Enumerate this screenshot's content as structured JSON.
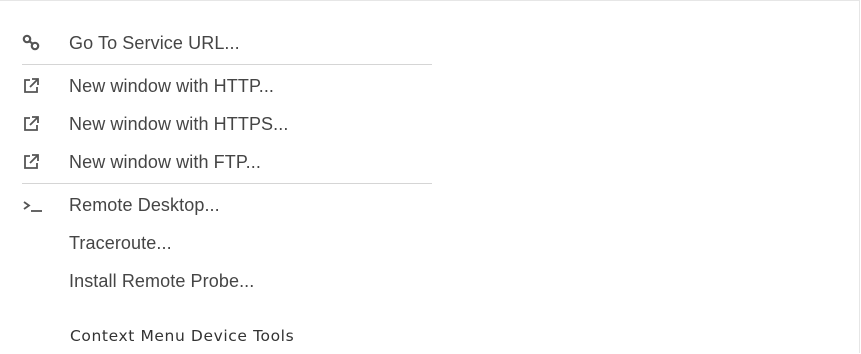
{
  "menu": {
    "items": [
      {
        "label": "Go To Service URL...",
        "icon": "link-icon"
      },
      {
        "label": "New window with HTTP...",
        "icon": "external-link-icon"
      },
      {
        "label": "New window with HTTPS...",
        "icon": "external-link-icon"
      },
      {
        "label": "New window with FTP...",
        "icon": "external-link-icon"
      },
      {
        "label": "Remote Desktop...",
        "icon": "terminal-icon"
      },
      {
        "label": "Traceroute...",
        "icon": ""
      },
      {
        "label": "Install Remote Probe...",
        "icon": ""
      }
    ]
  },
  "caption": "Context Menu Device Tools",
  "colors": {
    "text": "#454545",
    "divider": "#d5d5d5",
    "icon": "#555555"
  }
}
